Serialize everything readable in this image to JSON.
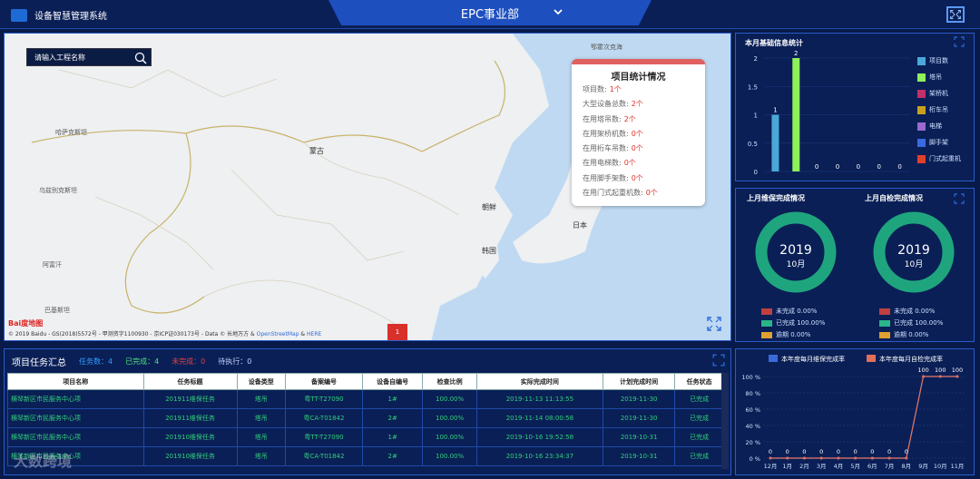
{
  "header": {
    "title": "设备智慧管理系统",
    "department": "EPC事业部"
  },
  "map": {
    "search_placeholder": "请输入工程名称",
    "labels": [
      "哈萨克斯坦",
      "乌兹别克斯坦",
      "阿富汗",
      "巴基斯坦",
      "蒙古",
      "朝鲜",
      "韩国",
      "日本",
      "鄂霍次克海"
    ],
    "attribution": "© 2019 Baidu - GS(2018)5572号 - 甲测资字1100930 - 京ICP证030173号 - Data © 长地万方 & ",
    "attribution_link1": "OpenStreetMap",
    "attribution_mid": " & ",
    "attribution_link2": "HERE",
    "baidu_logo": "Bai度地图",
    "marker_label": "1"
  },
  "stats_popup": {
    "title": "项目统计情况",
    "rows": [
      {
        "label": "项目数:",
        "value": "1个"
      },
      {
        "label": "大型设备总数:",
        "value": "2个"
      },
      {
        "label": "在用塔吊数:",
        "value": "2个"
      },
      {
        "label": "在用架桥机数:",
        "value": "0个"
      },
      {
        "label": "在用桁车吊数:",
        "value": "0个"
      },
      {
        "label": "在用电梯数:",
        "value": "0个"
      },
      {
        "label": "在用脚手架数:",
        "value": "0个"
      },
      {
        "label": "在用门式起重机数:",
        "value": "0个"
      }
    ]
  },
  "monthly_stats": {
    "title": "本月基础信息统计",
    "legend": [
      {
        "name": "项目数",
        "color": "#4aa8d8"
      },
      {
        "name": "塔吊",
        "color": "#8ef05a"
      },
      {
        "name": "架桥机",
        "color": "#c0306a"
      },
      {
        "name": "桁车吊",
        "color": "#c8a020"
      },
      {
        "name": "电梯",
        "color": "#9a6ad0"
      },
      {
        "name": "脚手架",
        "color": "#3a6ae0"
      },
      {
        "name": "门式起重机",
        "color": "#e0402a"
      }
    ]
  },
  "completion": {
    "maintenance_title": "上月维保完成情况",
    "inspection_title": "上月自检完成情况",
    "year": "2019",
    "month": "10月",
    "left_legend": [
      {
        "label": "未完成 0.00%",
        "color": "#c04040"
      },
      {
        "label": "已完成 100.00%",
        "color": "#2ab58a"
      },
      {
        "label": "逾期 0.00%",
        "color": "#e0a030"
      }
    ],
    "right_legend": [
      {
        "label": "未完成 0.00%",
        "color": "#c04040"
      },
      {
        "label": "已完成 100.00%",
        "color": "#2ab58a"
      },
      {
        "label": "逾期 0.00%",
        "color": "#e0a030"
      }
    ]
  },
  "tasks": {
    "title": "项目任务汇总",
    "summary_total": "任务数：4",
    "summary_done": "已完成：4",
    "summary_undone": "未完成：0",
    "summary_pending": "待执行：0",
    "columns": [
      "项目名称",
      "任务标题",
      "设备类型",
      "备案编号",
      "设备自编号",
      "检查比例",
      "实际完成时间",
      "计划完成时间",
      "任务状态"
    ],
    "rows": [
      [
        "横琴新区市民服务中心项",
        "201911维保任务",
        "塔吊",
        "粤TT-T27090",
        "1#",
        "100.00%",
        "2019-11-13 11:13:55",
        "2019-11-30",
        "已完成"
      ],
      [
        "横琴新区市民服务中心项",
        "201911维保任务",
        "塔吊",
        "粤CA-T01842",
        "2#",
        "100.00%",
        "2019-11-14 08:00:58",
        "2019-11-30",
        "已完成"
      ],
      [
        "横琴新区市民服务中心项",
        "201910维保任务",
        "塔吊",
        "粤TT-T27090",
        "1#",
        "100.00%",
        "2019-10-16 19:52:58",
        "2019-10-31",
        "已完成"
      ],
      [
        "横琴新区市民服务中心项",
        "201910维保任务",
        "塔吊",
        "粤CA-T01842",
        "2#",
        "100.00%",
        "2019-10-16 23:34:37",
        "2019-10-31",
        "已完成"
      ]
    ]
  },
  "watermark": "大数跨境",
  "chart_data": [
    {
      "type": "bar",
      "title": "本月基础信息统计",
      "categories": [
        "项目数",
        "塔吊",
        "架桥机",
        "桁车吊",
        "电梯",
        "脚手架",
        "门式起重机"
      ],
      "values": [
        1,
        2,
        0,
        0,
        0,
        0,
        0
      ],
      "ylim": [
        0,
        2
      ],
      "yticks": [
        "0",
        "0.5",
        "1",
        "1.5",
        "2"
      ],
      "colors": [
        "#4aa8d8",
        "#8ef05a",
        "#c0306a",
        "#c8a020",
        "#9a6ad0",
        "#3a6ae0",
        "#e0402a"
      ]
    },
    {
      "type": "pie",
      "title": "上月维保完成情况",
      "categories": [
        "未完成",
        "已完成",
        "逾期"
      ],
      "values": [
        0,
        100,
        0
      ]
    },
    {
      "type": "pie",
      "title": "上月自检完成情况",
      "categories": [
        "未完成",
        "已完成",
        "逾期"
      ],
      "values": [
        0,
        100,
        0
      ]
    },
    {
      "type": "line",
      "categories": [
        "12月",
        "1月",
        "2月",
        "3月",
        "4月",
        "5月",
        "6月",
        "7月",
        "8月",
        "9月",
        "10月",
        "11月"
      ],
      "series": [
        {
          "name": "本年度每月维保完成率",
          "color": "#3a6ad8",
          "values": [
            0,
            0,
            0,
            0,
            0,
            0,
            0,
            0,
            0,
            100,
            100,
            100
          ]
        },
        {
          "name": "本年度每月自检完成率",
          "color": "#e0705a",
          "values": [
            0,
            0,
            0,
            0,
            0,
            0,
            0,
            0,
            0,
            100,
            100,
            100
          ]
        }
      ],
      "yticks": [
        "0 %",
        "20 %",
        "40 %",
        "60 %",
        "80 %",
        "100 %"
      ],
      "ylim": [
        0,
        100
      ]
    }
  ]
}
